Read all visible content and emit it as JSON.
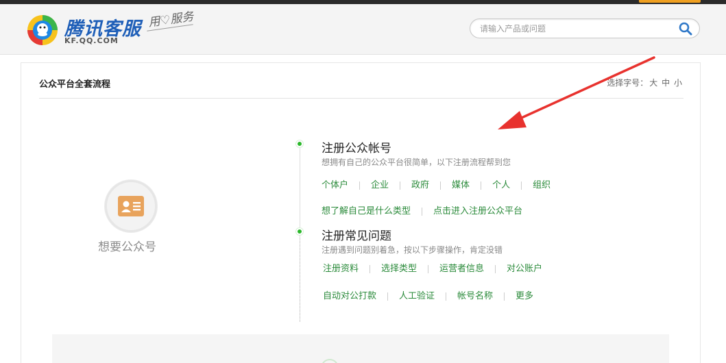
{
  "header": {
    "logo_text": "腾讯客服",
    "logo_sub": "KF.QQ.COM",
    "slogan": "用♡服务",
    "search": {
      "placeholder": "请输入产品或问题",
      "button_icon": "search-icon"
    }
  },
  "panel": {
    "title": "公众平台全套流程",
    "font_size_label": "选择字号：",
    "font_size_options": [
      "大",
      "中",
      "小"
    ]
  },
  "left": {
    "icon": "id-card-icon",
    "label": "想要公众号"
  },
  "sections": [
    {
      "title": "注册公众帐号",
      "desc": "想拥有自己的公众平台很简单，以下注册流程帮到您",
      "rows": [
        [
          "个体户",
          "企业",
          "政府",
          "媒体",
          "个人",
          "组织"
        ],
        [
          "想了解自己是什么类型",
          "点击进入注册公众平台"
        ]
      ]
    },
    {
      "title": "注册常见问题",
      "desc": "注册遇到问题别着急，按以下步骤操作，肯定没错",
      "rows": [
        [
          "注册资料",
          "选择类型",
          "运营者信息",
          "对公账户"
        ],
        [
          "自动对公打款",
          "人工验证",
          "帐号名称",
          "更多"
        ]
      ]
    }
  ],
  "colors": {
    "link": "#2a8a3a",
    "dot": "#2ab82a",
    "brand_blue": "#1f5fb8",
    "annotation_arrow": "#e8322e"
  }
}
